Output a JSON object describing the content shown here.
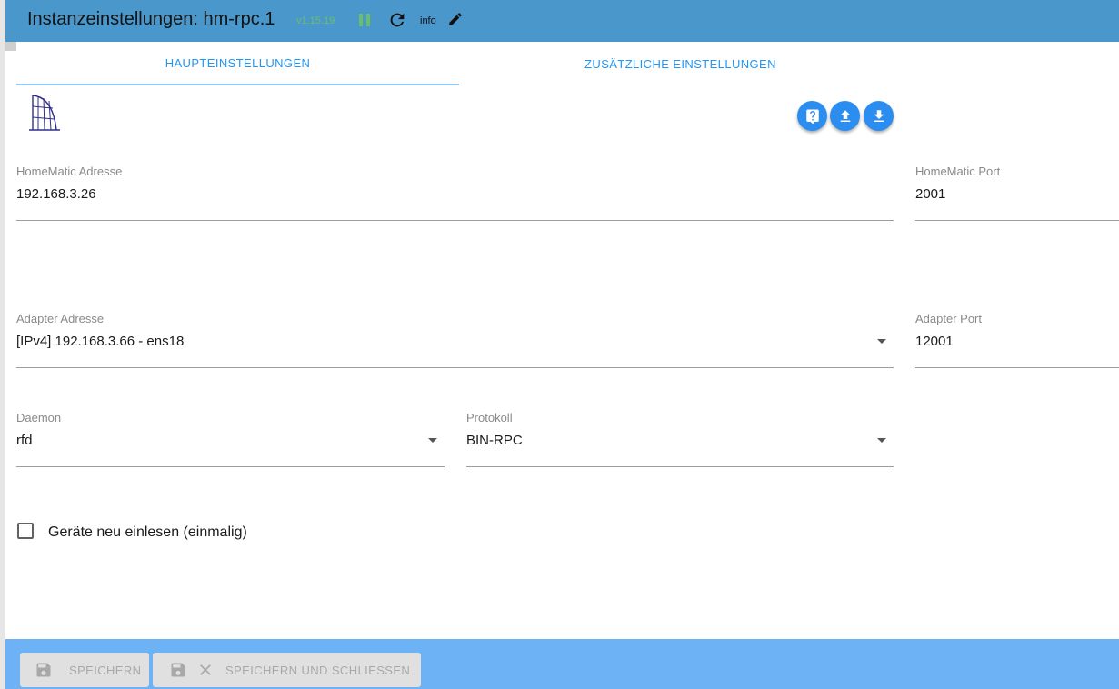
{
  "header": {
    "title": "Instanzeinstellungen: hm-rpc.1",
    "version": "v1.15.19",
    "loglevel": "info",
    "icons": {
      "pause": "pause-icon",
      "refresh": "refresh-icon",
      "edit": "pencil-icon"
    },
    "colors": {
      "bar": "#4a97cb",
      "version": "#6abf6a"
    }
  },
  "tabs": [
    {
      "label": "HAUPTEINSTELLUNGEN",
      "active": true
    },
    {
      "label": "ZUSÄTZLICHE EINSTELLUNGEN",
      "active": false
    }
  ],
  "logo": {
    "text": "HomeMatic"
  },
  "actions": {
    "help_icon": "help-icon",
    "upload_icon": "upload-icon",
    "download_icon": "download-icon",
    "color": "#2b8df0"
  },
  "form": {
    "homematic_address": {
      "label": "HomeMatic Adresse",
      "value": "192.168.3.26"
    },
    "homematic_port": {
      "label": "HomeMatic Port",
      "value": "2001"
    },
    "adapter_address": {
      "label": "Adapter Adresse",
      "value": "[IPv4] 192.168.3.66 - ens18"
    },
    "adapter_port": {
      "label": "Adapter Port",
      "value": "12001"
    },
    "daemon": {
      "label": "Daemon",
      "value": "rfd"
    },
    "protocol": {
      "label": "Protokoll",
      "value": "BIN-RPC"
    },
    "reread_devices": {
      "label": "Geräte neu einlesen (einmalig)",
      "checked": false
    }
  },
  "footer": {
    "save_label": "SPEICHERN",
    "save_close_label": "SPEICHERN UND SCHLIESSEN",
    "color": "#6cb2f4"
  }
}
